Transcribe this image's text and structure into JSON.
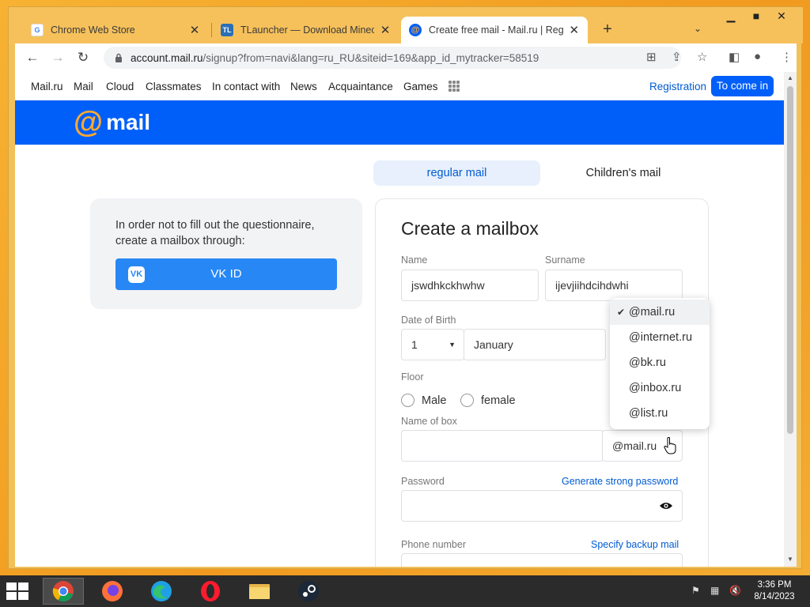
{
  "browser": {
    "tabs": [
      {
        "title": "Chrome Web Store",
        "favicon": "chrome-store-icon",
        "active": false
      },
      {
        "title": "TLauncher — Download Minecraft",
        "favicon": "tlauncher-icon",
        "active": false
      },
      {
        "title": "Create free mail - Mail.ru | Registration",
        "favicon": "mailru-icon",
        "active": true
      }
    ],
    "url_host": "account.mail.ru",
    "url_path": "/signup?from=navi&lang=ru_RU&siteid=169&app_id_mytracker=58519"
  },
  "portal_nav": {
    "links": [
      "Mail.ru",
      "Mail",
      "Cloud",
      "Classmates",
      "In contact with",
      "News",
      "Acquaintance",
      "Games"
    ],
    "registration": "Registration",
    "login": "To come in"
  },
  "banner": {
    "logo_at": "@",
    "logo_word": "mail"
  },
  "mail_type_tabs": {
    "regular": "regular mail",
    "children": "Children's mail"
  },
  "vk_card": {
    "text": "In order not to fill out the questionnaire, create a mailbox through:",
    "button": "VK ID",
    "logo": "VK"
  },
  "form": {
    "title": "Create a mailbox",
    "name_label": "Name",
    "name_value": "jswdhkckhwhw",
    "surname_label": "Surname",
    "surname_value": "ijevjiihdcihdwhi",
    "dob_label": "Date of Birth",
    "dob_day": "1",
    "dob_month": "January",
    "floor_label": "Floor",
    "male": "Male",
    "female": "female",
    "box_label": "Name of box",
    "box_value": "",
    "domain_selected": "@mail.ru",
    "password_label": "Password",
    "generate_link": "Generate strong password",
    "phone_label": "Phone number",
    "backup_link": "Specify backup mail"
  },
  "domain_dropdown": {
    "options": [
      "@mail.ru",
      "@internet.ru",
      "@bk.ru",
      "@inbox.ru",
      "@list.ru"
    ],
    "selected_index": 0
  },
  "taskbar": {
    "time": "3:36 PM",
    "date": "8/14/2023",
    "apps": [
      "chrome-icon",
      "firefox-icon",
      "edge-icon",
      "opera-icon",
      "file-explorer-icon",
      "steam-icon"
    ]
  }
}
